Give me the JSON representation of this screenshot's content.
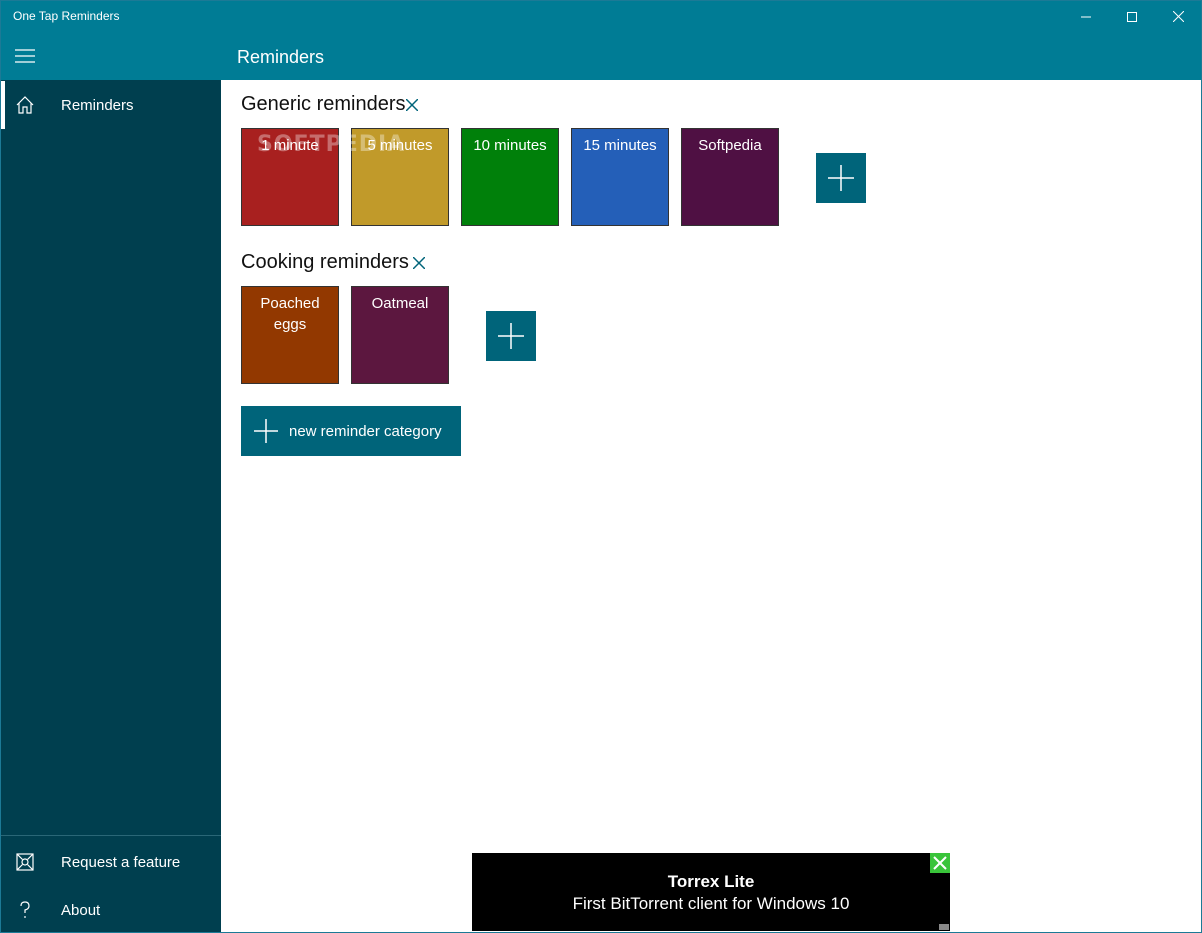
{
  "window": {
    "title": "One Tap Reminders"
  },
  "header": {
    "page_title": "Reminders"
  },
  "sidebar": {
    "items": [
      {
        "label": "Reminders",
        "icon": "home-icon",
        "active": true
      },
      {
        "label": "Request a feature",
        "icon": "feature-icon"
      },
      {
        "label": "About",
        "icon": "question-icon"
      }
    ]
  },
  "categories": [
    {
      "title": "Generic reminders",
      "tiles": [
        {
          "label": "1 minute",
          "color": "#a8201f"
        },
        {
          "label": "5 minutes",
          "color": "#c19a2a"
        },
        {
          "label": "10 minutes",
          "color": "#00800a"
        },
        {
          "label": "15 minutes",
          "color": "#245fb8"
        },
        {
          "label": "Softpedia",
          "color": "#4f1043"
        }
      ]
    },
    {
      "title": "Cooking reminders",
      "tiles": [
        {
          "label": "Poached eggs",
          "color": "#923800"
        },
        {
          "label": "Oatmeal",
          "color": "#5c173f"
        }
      ]
    }
  ],
  "new_category_label": "new reminder category",
  "watermark": "SOFTPEDIA",
  "ad": {
    "title": "Torrex Lite",
    "subtitle": "First BitTorrent client for Windows 10"
  },
  "colors": {
    "accent": "#007c95",
    "sidebar_bg": "#003f4f",
    "button_bg": "#00647a"
  }
}
